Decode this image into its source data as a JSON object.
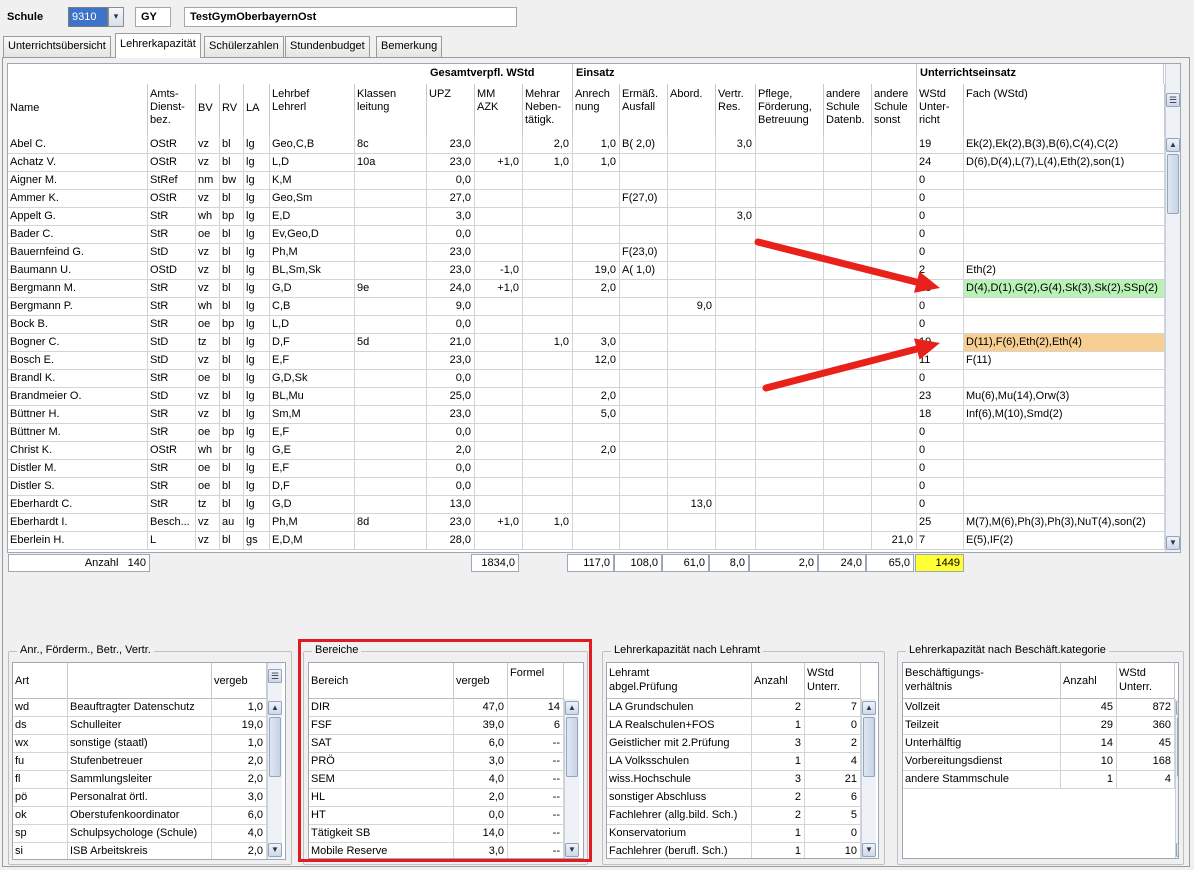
{
  "header": {
    "schule_label": "Schule",
    "schule_number": "9310",
    "schultyp": "GY",
    "schulname": "TestGymOberbayernOst",
    "dropdown_glyph": "▾"
  },
  "tabs": [
    "Unterrichtsübersicht",
    "Lehrerkapazität",
    "Schülerzahlen",
    "Stundenbudget",
    "Bemerkung"
  ],
  "grid": {
    "group_headers": {
      "gesamt": "Gesamtverpfl. WStd",
      "einsatz": "Einsatz",
      "unterricht": "Unterrichtseinsatz"
    },
    "columns": [
      "Name",
      "Amts-\nDienst-\nbez.",
      "BV",
      "RV",
      "LA",
      "Lehrbef\nLehrerl",
      "Klassen\nleitung",
      "UPZ",
      "MM\nAZK",
      "Mehrar\nNeben-\ntätigk.",
      "Anrech\nnung",
      "Ermäß.\nAusfall",
      "Abord.",
      "Vertr.\nRes.",
      "Pflege,\nFörderung,\nBetreuung",
      "andere\nSchule\nDatenb.",
      "andere\nSchule\nsonst",
      "WStd\nUnter-\nricht",
      "Fach (WStd)"
    ],
    "rows": [
      [
        "Abel C.",
        "OStR",
        "vz",
        "bl",
        "lg",
        "Geo,C,B",
        "8c",
        "23,0",
        "",
        "2,0",
        "1,0",
        "B( 2,0)",
        "",
        "3,0",
        "",
        "",
        "",
        "19",
        "Ek(2),Ek(2),B(3),B(6),C(4),C(2)"
      ],
      [
        "Achatz V.",
        "OStR",
        "vz",
        "bl",
        "lg",
        "L,D",
        "10a",
        "23,0",
        "+1,0",
        "1,0",
        "1,0",
        "",
        "",
        "",
        "",
        "",
        "",
        "24",
        "D(6),D(4),L(7),L(4),Eth(2),son(1)"
      ],
      [
        "Aigner M.",
        "StRef",
        "nm",
        "bw",
        "lg",
        "K,M",
        "",
        "0,0",
        "",
        "",
        "",
        "",
        "",
        "",
        "",
        "",
        "",
        "0",
        ""
      ],
      [
        "Ammer K.",
        "OStR",
        "vz",
        "bl",
        "lg",
        "Geo,Sm",
        "",
        "27,0",
        "",
        "",
        "",
        "F(27,0)",
        "",
        "",
        "",
        "",
        "",
        "0",
        ""
      ],
      [
        "Appelt G.",
        "StR",
        "wh",
        "bp",
        "lg",
        "E,D",
        "",
        "3,0",
        "",
        "",
        "",
        "",
        "",
        "3,0",
        "",
        "",
        "",
        "0",
        ""
      ],
      [
        "Bader C.",
        "StR",
        "oe",
        "bl",
        "lg",
        "Ev,Geo,D",
        "",
        "0,0",
        "",
        "",
        "",
        "",
        "",
        "",
        "",
        "",
        "",
        "0",
        ""
      ],
      [
        "Bauernfeind G.",
        "StD",
        "vz",
        "bl",
        "lg",
        "Ph,M",
        "",
        "23,0",
        "",
        "",
        "",
        "F(23,0)",
        "",
        "",
        "",
        "",
        "",
        "0",
        ""
      ],
      [
        "Baumann U.",
        "OStD",
        "vz",
        "bl",
        "lg",
        "BL,Sm,Sk",
        "",
        "23,0",
        "-1,0",
        "",
        "19,0",
        "A( 1,0)",
        "",
        "",
        "",
        "",
        "",
        "2",
        "Eth(2)"
      ],
      [
        "Bergmann M.",
        "StR",
        "vz",
        "bl",
        "lg",
        "G,D",
        "9e",
        "24,0",
        "+1,0",
        "",
        "2,0",
        "",
        "",
        "",
        "",
        "",
        "",
        "23",
        "D(4),D(1),G(2),G(4),Sk(3),Sk(2),SSp(2)"
      ],
      [
        "Bergmann P.",
        "StR",
        "wh",
        "bl",
        "lg",
        "C,B",
        "",
        "9,0",
        "",
        "",
        "",
        "",
        "9,0",
        "",
        "",
        "",
        "",
        "0",
        ""
      ],
      [
        "Bock B.",
        "StR",
        "oe",
        "bp",
        "lg",
        "L,D",
        "",
        "0,0",
        "",
        "",
        "",
        "",
        "",
        "",
        "",
        "",
        "",
        "0",
        ""
      ],
      [
        "Bogner C.",
        "StD",
        "tz",
        "bl",
        "lg",
        "D,F",
        "5d",
        "21,0",
        "",
        "1,0",
        "3,0",
        "",
        "",
        "",
        "",
        "",
        "",
        "19",
        "D(11),F(6),Eth(2),Eth(4)"
      ],
      [
        "Bosch E.",
        "StD",
        "vz",
        "bl",
        "lg",
        "E,F",
        "",
        "23,0",
        "",
        "",
        "12,0",
        "",
        "",
        "",
        "",
        "",
        "",
        "11",
        "F(11)"
      ],
      [
        "Brandl K.",
        "StR",
        "oe",
        "bl",
        "lg",
        "G,D,Sk",
        "",
        "0,0",
        "",
        "",
        "",
        "",
        "",
        "",
        "",
        "",
        "",
        "0",
        ""
      ],
      [
        "Brandmeier O.",
        "StD",
        "vz",
        "bl",
        "lg",
        "BL,Mu",
        "",
        "25,0",
        "",
        "",
        "2,0",
        "",
        "",
        "",
        "",
        "",
        "",
        "23",
        "Mu(6),Mu(14),Orw(3)"
      ],
      [
        "Büttner H.",
        "StR",
        "vz",
        "bl",
        "lg",
        "Sm,M",
        "",
        "23,0",
        "",
        "",
        "5,0",
        "",
        "",
        "",
        "",
        "",
        "",
        "18",
        "Inf(6),M(10),Smd(2)"
      ],
      [
        "Büttner M.",
        "StR",
        "oe",
        "bp",
        "lg",
        "E,F",
        "",
        "0,0",
        "",
        "",
        "",
        "",
        "",
        "",
        "",
        "",
        "",
        "0",
        ""
      ],
      [
        "Christ K.",
        "OStR",
        "wh",
        "br",
        "lg",
        "G,E",
        "",
        "2,0",
        "",
        "",
        "2,0",
        "",
        "",
        "",
        "",
        "",
        "",
        "0",
        ""
      ],
      [
        "Distler M.",
        "StR",
        "oe",
        "bl",
        "lg",
        "E,F",
        "",
        "0,0",
        "",
        "",
        "",
        "",
        "",
        "",
        "",
        "",
        "",
        "0",
        ""
      ],
      [
        "Distler S.",
        "StR",
        "oe",
        "bl",
        "lg",
        "D,F",
        "",
        "0,0",
        "",
        "",
        "",
        "",
        "",
        "",
        "",
        "",
        "",
        "0",
        ""
      ],
      [
        "Eberhardt C.",
        "StR",
        "tz",
        "bl",
        "lg",
        "G,D",
        "",
        "13,0",
        "",
        "",
        "",
        "",
        "13,0",
        "",
        "",
        "",
        "",
        "0",
        ""
      ],
      [
        "Eberhardt I.",
        "Besch...",
        "vz",
        "au",
        "lg",
        "Ph,M",
        "8d",
        "23,0",
        "+1,0",
        "1,0",
        "",
        "",
        "",
        "",
        "",
        "",
        "",
        "25",
        "M(7),M(6),Ph(3),Ph(3),NuT(4),son(2)"
      ],
      [
        "Eberlein H.",
        "L",
        "vz",
        "bl",
        "gs",
        "E,D,M",
        "",
        "28,0",
        "",
        "",
        "",
        "",
        "",
        "",
        "",
        "",
        "21,0",
        "7",
        "E(5),IF(2)"
      ]
    ],
    "highlight_rows": {
      "8": "#b9f2b6",
      "11": "#f7cf93"
    },
    "totals": {
      "anzahl_label": "Anzahl",
      "anzahl": "140",
      "upz": "1834,0",
      "anrechnung": "117,0",
      "ermaess": "108,0",
      "abord": "61,0",
      "vertr": "8,0",
      "pflege": "2,0",
      "andere_datenb": "24,0",
      "andere_sonst": "65,0",
      "wstd": "1449"
    },
    "totals_highlight": "#ffff33"
  },
  "annotation": {
    "arrow_color": "#e8211b",
    "highlight_box_color": "#e01b24"
  },
  "anr_panel": {
    "title": "Anr., Förderm., Betr., Vertr.",
    "columns": [
      "Art",
      "",
      "vergeb"
    ],
    "rows": [
      [
        "wd",
        "Beauftragter Datenschutz",
        "1,0"
      ],
      [
        "ds",
        "Schulleiter",
        "19,0"
      ],
      [
        "wx",
        "sonstige (staatl)",
        "1,0"
      ],
      [
        "fu",
        "Stufenbetreuer",
        "2,0"
      ],
      [
        "fl",
        "Sammlungsleiter",
        "2,0"
      ],
      [
        "pö",
        "Personalrat örtl.",
        "3,0"
      ],
      [
        "ok",
        "Oberstufenkoordinator",
        "6,0"
      ],
      [
        "sp",
        "Schulpsychologe (Schule)",
        "4,0"
      ],
      [
        "si",
        "ISB Arbeitskreis",
        "2,0"
      ]
    ]
  },
  "bereiche_panel": {
    "title": "Bereiche",
    "columns": [
      "Bereich",
      "vergeb",
      "Formel"
    ],
    "rows": [
      [
        "DIR",
        "47,0",
        "14"
      ],
      [
        "FSF",
        "39,0",
        "6"
      ],
      [
        "SAT",
        "6,0",
        "--"
      ],
      [
        "PRÖ",
        "3,0",
        "--"
      ],
      [
        "SEM",
        "4,0",
        "--"
      ],
      [
        "HL",
        "2,0",
        "--"
      ],
      [
        "HT",
        "0,0",
        "--"
      ],
      [
        "Tätigkeit SB",
        "14,0",
        "--"
      ],
      [
        "Mobile Reserve",
        "3,0",
        "--"
      ]
    ]
  },
  "lehramt_panel": {
    "title": "Lehrerkapazität nach Lehramt",
    "columns": [
      "Lehramt\nabgel.Prüfung",
      "Anzahl",
      "WStd\nUnterr."
    ],
    "rows": [
      [
        "LA Grundschulen",
        "2",
        "7"
      ],
      [
        "LA Realschulen+FOS",
        "1",
        "0"
      ],
      [
        "Geistlicher mit 2.Prüfung",
        "3",
        "2"
      ],
      [
        "LA Volksschulen",
        "1",
        "4"
      ],
      [
        "wiss.Hochschule",
        "3",
        "21"
      ],
      [
        "sonstiger Abschluss",
        "2",
        "6"
      ],
      [
        "Fachlehrer (allg.bild. Sch.)",
        "2",
        "5"
      ],
      [
        "Konservatorium",
        "1",
        "0"
      ],
      [
        "Fachlehrer (berufl. Sch.)",
        "1",
        "10"
      ]
    ]
  },
  "beschaeft_panel": {
    "title": "Lehrerkapazität nach Beschäft.kategorie",
    "columns": [
      "Beschäftigungs-\nverhältnis",
      "Anzahl",
      "WStd\nUnterr."
    ],
    "rows": [
      [
        "Vollzeit",
        "45",
        "872"
      ],
      [
        "Teilzeit",
        "29",
        "360"
      ],
      [
        "Unterhälftig",
        "14",
        "45"
      ],
      [
        "Vorbereitungsdienst",
        "10",
        "168"
      ],
      [
        "andere Stammschule",
        "1",
        "4"
      ]
    ]
  }
}
